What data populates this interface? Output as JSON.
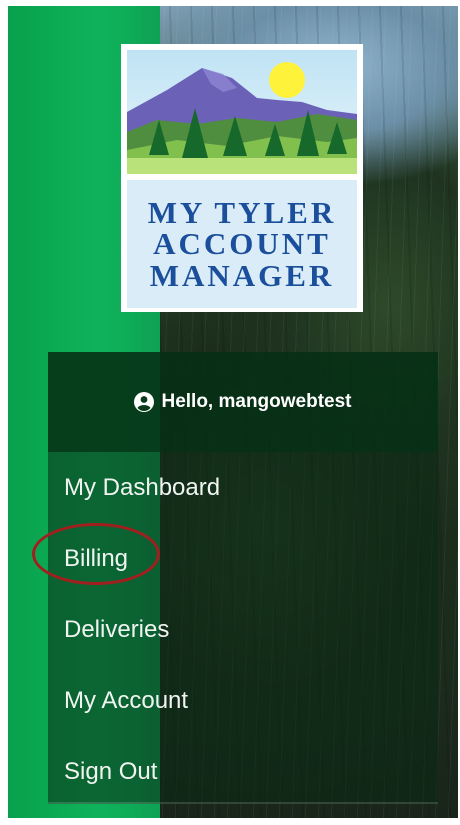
{
  "logo": {
    "line1": "MY TYLER",
    "line2": "ACCOUNT",
    "line3": "MANAGER"
  },
  "greeting": {
    "icon": "user-circle-icon",
    "text": "Hello, mangowebtest"
  },
  "menu": {
    "items": [
      {
        "label": "My Dashboard"
      },
      {
        "label": "Billing"
      },
      {
        "label": "Deliveries"
      },
      {
        "label": "My Account"
      },
      {
        "label": "Sign Out"
      }
    ]
  },
  "colors": {
    "green_band": "#0fb35b",
    "logo_text": "#1b4f9c",
    "highlight_ring": "#a21f1f"
  }
}
